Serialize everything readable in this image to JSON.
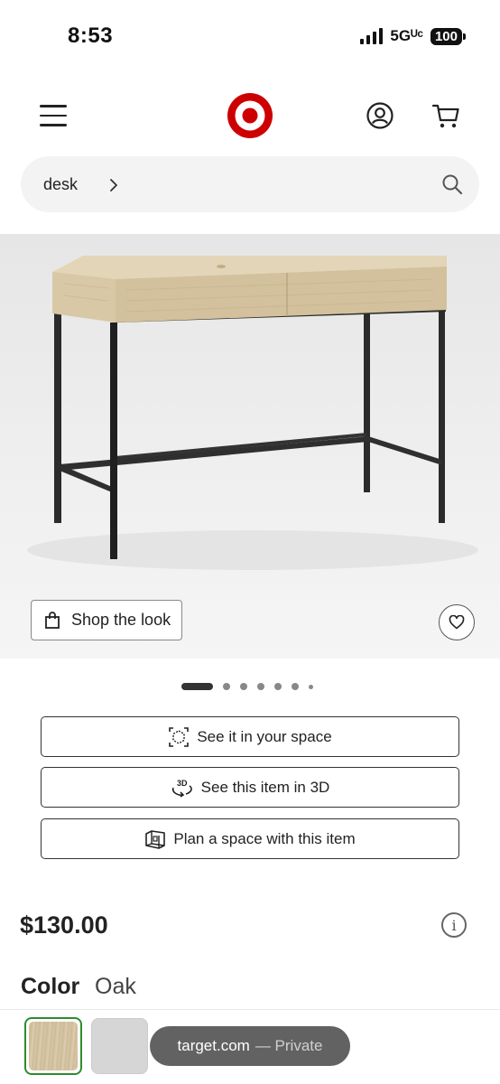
{
  "status_bar": {
    "time": "8:53",
    "network": "5Gᵁᶜ",
    "battery": "100"
  },
  "header": {
    "menu_icon": "hamburger-icon",
    "logo_icon": "target-bullseye-logo",
    "account_icon": "account-icon",
    "cart_icon": "cart-icon",
    "brand_color": "#cc0000"
  },
  "search": {
    "query": "desk",
    "search_icon": "magnifier-icon"
  },
  "product_image": {
    "alt": "Wood-top desk with two drawers and black metal frame",
    "shop_the_look_label": "Shop the look",
    "favorite_icon": "heart-icon"
  },
  "carousel": {
    "active_index": 0,
    "total": 7
  },
  "actions": [
    {
      "label": "See it in your space",
      "icon": "ar-cube-icon"
    },
    {
      "label": "See this item in 3D",
      "icon": "3d-rotate-icon"
    },
    {
      "label": "Plan a space with this item",
      "icon": "plan-room-icon"
    }
  ],
  "product": {
    "price": "$130.00",
    "color_label": "Color",
    "color_value": "Oak"
  },
  "swatches": [
    {
      "name": "Oak",
      "selected": true,
      "color": "#d3c29f"
    },
    {
      "name": "Gray",
      "selected": false,
      "color": "#d6d6d6"
    }
  ],
  "browser_toast": {
    "site": "target.com",
    "mode": "— Private"
  }
}
